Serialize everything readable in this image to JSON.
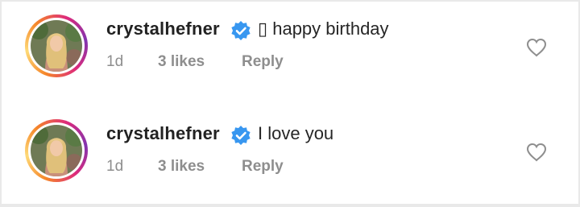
{
  "comments": [
    {
      "username": "crystalhefner",
      "text": "▯ happy birthday",
      "time": "1d",
      "likes": "3 likes",
      "reply": "Reply"
    },
    {
      "username": "crystalhefner",
      "text": "I love you",
      "time": "1d",
      "likes": "3 likes",
      "reply": "Reply"
    }
  ],
  "colors": {
    "verified": "#3897f0",
    "meta": "#8e8e8e",
    "username": "#222222"
  },
  "icons": [
    "verified-badge-icon",
    "heart-outline-icon"
  ]
}
